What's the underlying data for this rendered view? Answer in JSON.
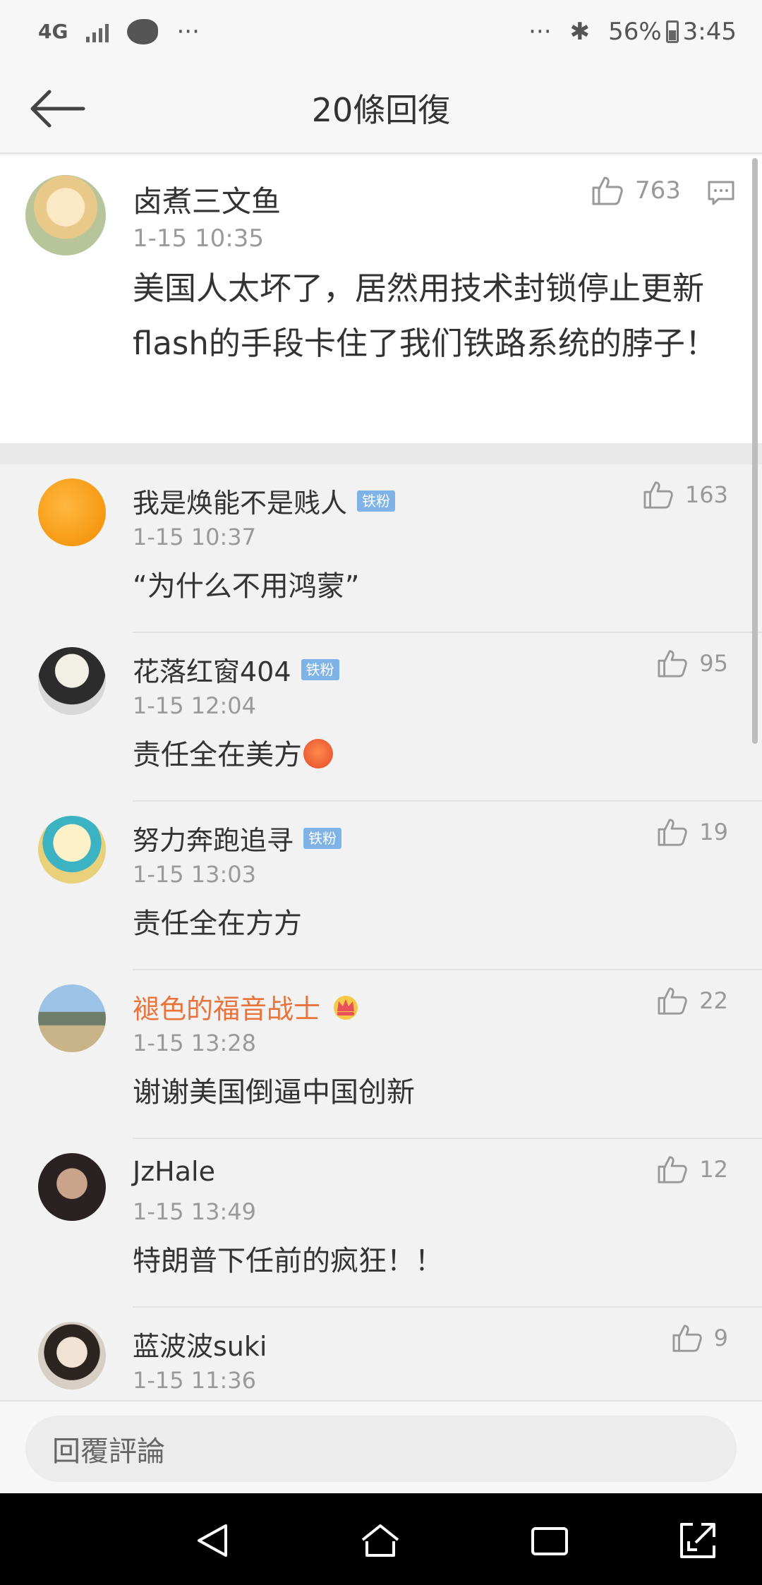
{
  "status_bar": {
    "network": "4G",
    "dots_left": "···",
    "dots_right": "···",
    "battery": "56%",
    "time": "3:45"
  },
  "nav": {
    "title": "20條回復"
  },
  "main_comment": {
    "name": "卤煮三文鱼",
    "time": "1-15 10:35",
    "likes": "763",
    "text": "美国人太坏了，居然用技术封锁停止更新flash的手段卡住了我们铁路系统的脖子！"
  },
  "badge_label": "铁粉",
  "replies": [
    {
      "name": "我是焕能不是贱人",
      "badge": true,
      "time": "1-15 10:37",
      "likes": "163",
      "text": "“为什么不用鸿蒙”",
      "avatar_color": "#f7a11a"
    },
    {
      "name": "花落红窗404",
      "badge": true,
      "time": "1-15 12:04",
      "likes": "95",
      "text": "责任全在美方",
      "emoji": "angry-emoji",
      "avatar_color": "#444444"
    },
    {
      "name": "努力奔跑追寻",
      "badge": true,
      "time": "1-15 13:03",
      "likes": "19",
      "text": "责任全在方方",
      "avatar_color": "#f0d27a"
    },
    {
      "name": "褪色的福音战士",
      "vip": true,
      "time": "1-15 13:28",
      "likes": "22",
      "text": "谢谢美国倒逼中国创新",
      "avatar_color": "#6c8fb5"
    },
    {
      "name": "JzHale",
      "time": "1-15 13:49",
      "likes": "12",
      "text": "特朗普下任前的疯狂！！",
      "avatar_color": "#3a3030"
    },
    {
      "name": "蓝波波suki",
      "time": "1-15 11:36",
      "likes": "9",
      "text": "",
      "avatar_color": "#c9b8a6"
    }
  ],
  "reply_bar": {
    "placeholder": "回覆評論"
  },
  "colors": {
    "accent_vip": "#e8743b",
    "badge_blue": "#7fb3e8"
  }
}
